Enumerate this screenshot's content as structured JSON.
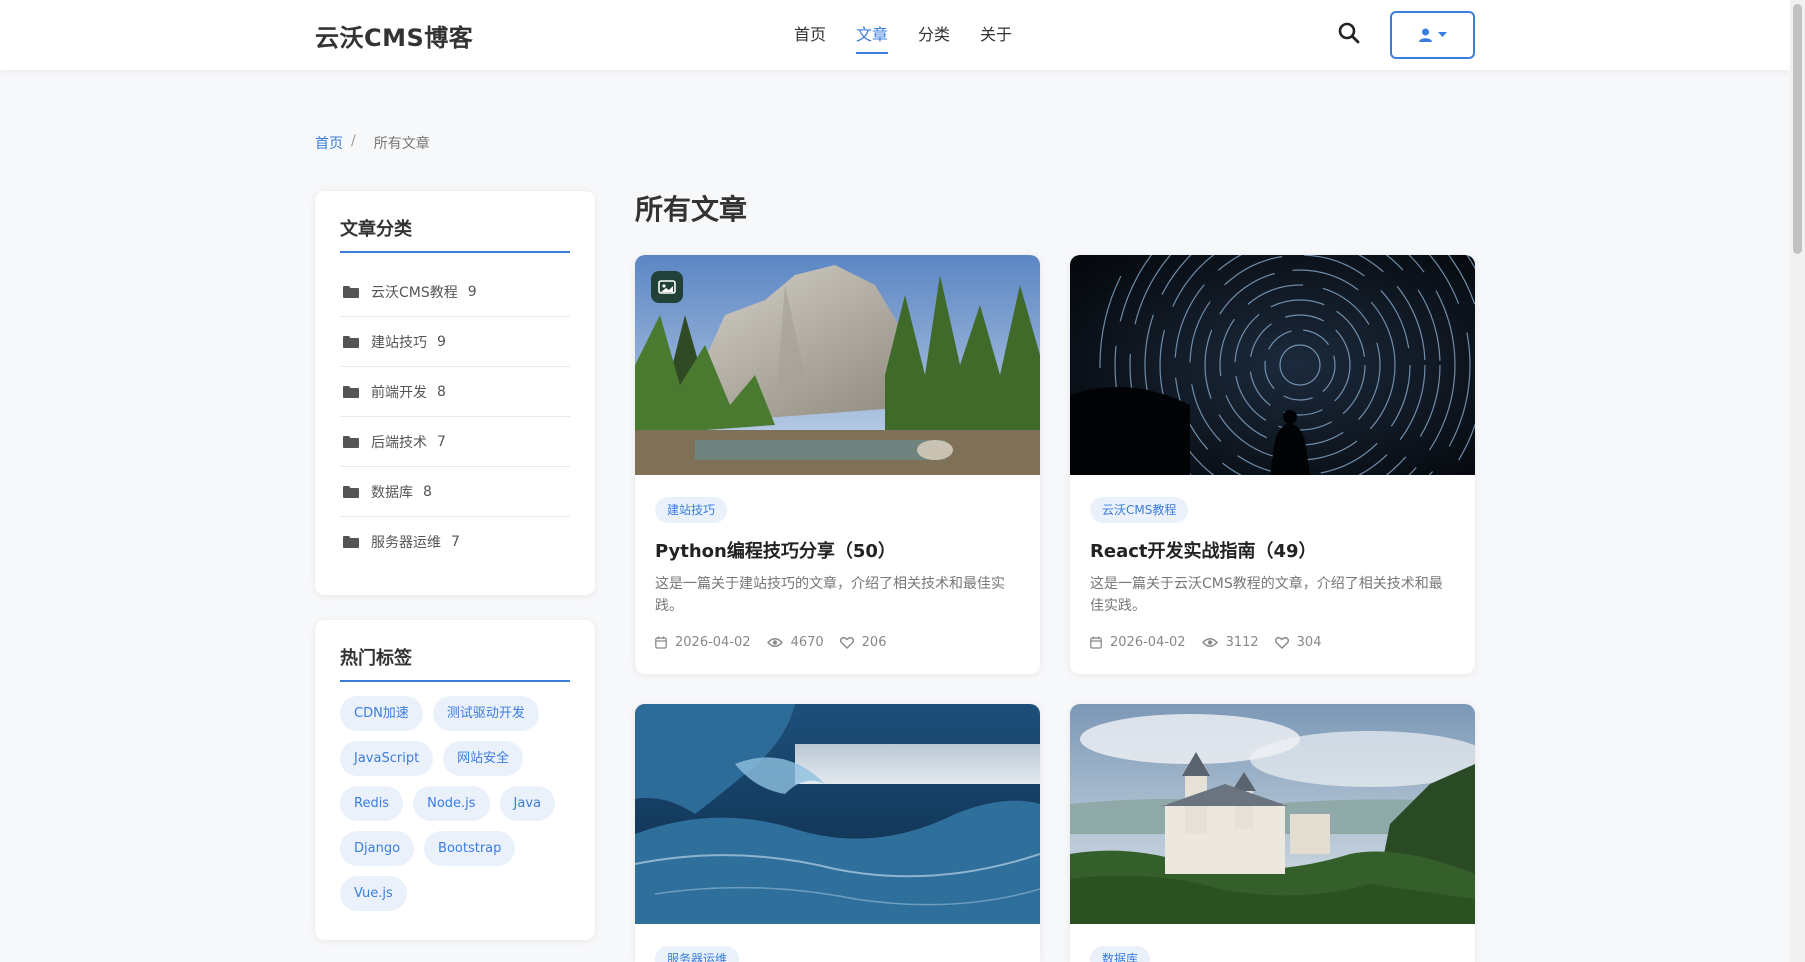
{
  "header": {
    "brand": "云沃CMS博客",
    "nav": [
      "首页",
      "文章",
      "分类",
      "关于"
    ],
    "active_index": 1
  },
  "breadcrumb": {
    "home": "首页",
    "separator": "/",
    "current": "所有文章"
  },
  "sidebar": {
    "categories_title": "文章分类",
    "categories": [
      {
        "name": "云沃CMS教程",
        "count": "9"
      },
      {
        "name": "建站技巧",
        "count": "9"
      },
      {
        "name": "前端开发",
        "count": "8"
      },
      {
        "name": "后端技术",
        "count": "7"
      },
      {
        "name": "数据库",
        "count": "8"
      },
      {
        "name": "服务器运维",
        "count": "7"
      }
    ],
    "tags_title": "热门标签",
    "tags": [
      "CDN加速",
      "测试驱动开发",
      "JavaScript",
      "网站安全",
      "Redis",
      "Node.js",
      "Java",
      "Django",
      "Bootstrap",
      "Vue.js"
    ]
  },
  "main": {
    "title": "所有文章",
    "posts": [
      {
        "category": "建站技巧",
        "title": "Python编程技巧分享（50）",
        "excerpt": "这是一篇关于建站技巧的文章，介绍了相关技术和最佳实践。",
        "date": "2026-04-02",
        "views": "4670",
        "likes": "206"
      },
      {
        "category": "云沃CMS教程",
        "title": "React开发实战指南（49）",
        "excerpt": "这是一篇关于云沃CMS教程的文章，介绍了相关技术和最佳实践。",
        "date": "2026-04-02",
        "views": "3112",
        "likes": "304"
      },
      {
        "category": "服务器运维"
      },
      {
        "category": "数据库"
      }
    ]
  },
  "colors": {
    "accent": "#3b7ddd",
    "tag_bg": "#eaf1fb"
  }
}
